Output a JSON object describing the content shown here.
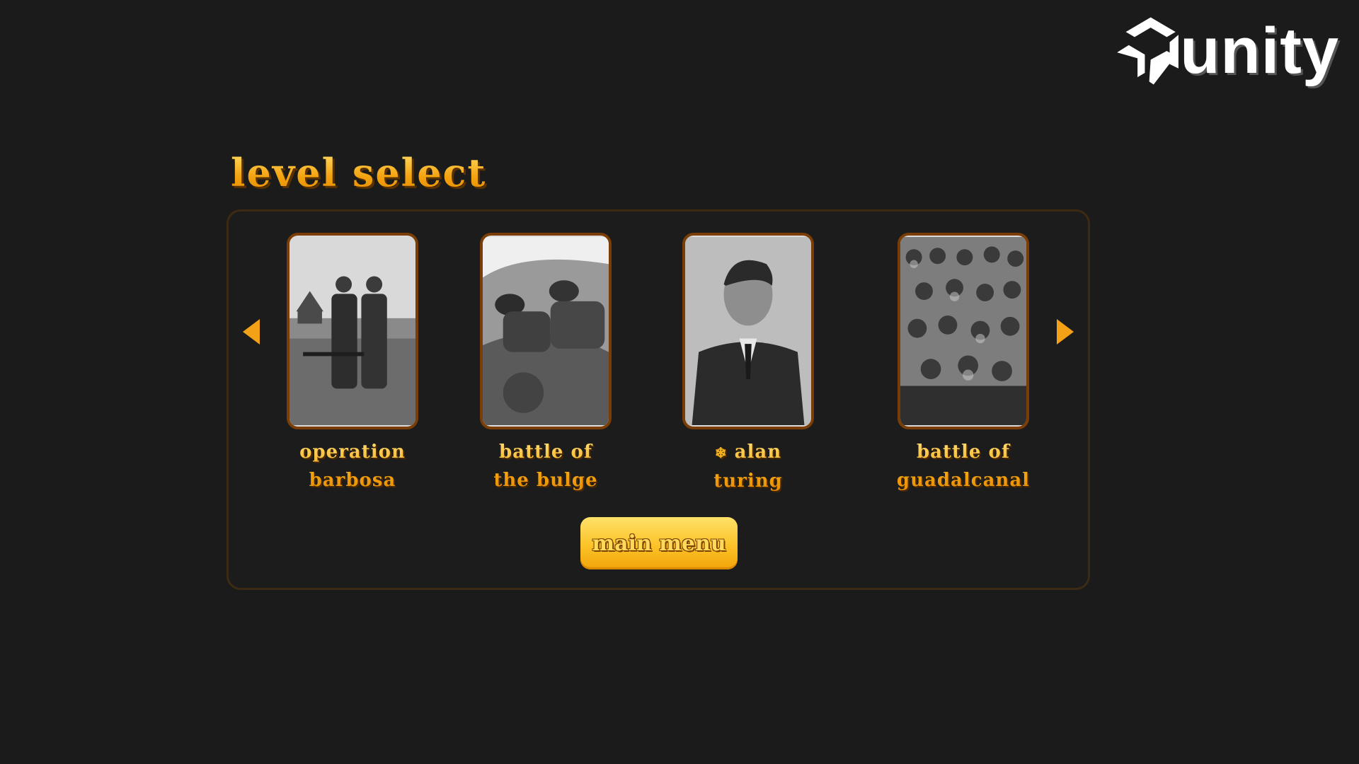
{
  "brand": {
    "logo_text": "unity",
    "icon": "unity-cube-icon"
  },
  "title": "level select",
  "navigation": {
    "prev_icon": "arrow-left-icon",
    "next_icon": "arrow-right-icon"
  },
  "levels": [
    {
      "line1": "operation",
      "line2": "barbosa",
      "locked": false,
      "image": "soldiers-photo"
    },
    {
      "line1": "battle of",
      "line2": "the bulge",
      "locked": false,
      "image": "trench-photo"
    },
    {
      "line1": "alan",
      "line2": "turing",
      "locked": true,
      "lock_glyph": "❄",
      "image": "portrait-photo"
    },
    {
      "line1": "battle of",
      "line2": "guadalcanal",
      "locked": false,
      "image": "troops-photo"
    }
  ],
  "main_menu_label": "main menu",
  "colors": {
    "accent": "#f6a817",
    "background": "#1b1b1b",
    "frame": "#7a3d05",
    "button": "#fbc328"
  }
}
